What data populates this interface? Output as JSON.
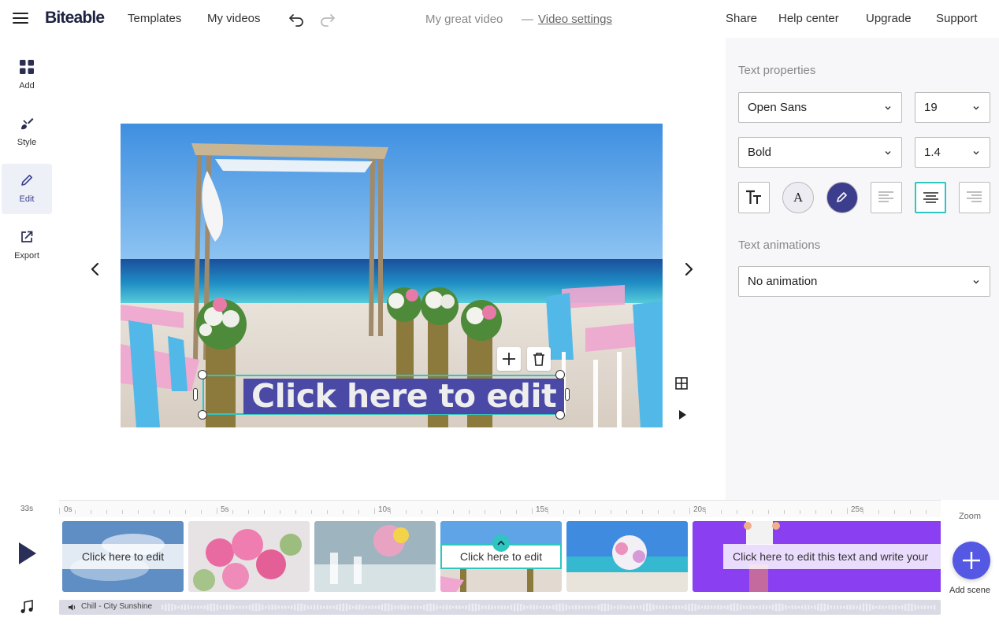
{
  "topbar": {
    "logo": "Biteable",
    "nav": [
      "Templates",
      "My videos"
    ],
    "video_title": "My great video",
    "separator": "—",
    "video_settings": "Video settings",
    "right_links": [
      "Share",
      "Help center",
      "Upgrade",
      "Support"
    ]
  },
  "left_toolbar": [
    {
      "label": "Add",
      "icon": "grid-icon"
    },
    {
      "label": "Style",
      "icon": "paint-brush-icon"
    },
    {
      "label": "Edit",
      "icon": "pencil-icon",
      "active": true
    },
    {
      "label": "Export",
      "icon": "export-icon"
    }
  ],
  "canvas": {
    "caption": "Click here to edit"
  },
  "properties": {
    "text_properties_title": "Text properties",
    "font_family": "Open Sans",
    "font_size": "19",
    "font_weight": "Bold",
    "line_height": "1.4",
    "color_letter": "A",
    "text_animations_title": "Text animations",
    "animation": "No animation",
    "alignment": "center"
  },
  "timeline": {
    "duration": "33s",
    "ruler_marks": [
      "0s",
      "5s",
      "10s",
      "15s",
      "20s",
      "25s"
    ],
    "clips": [
      {
        "label": "Click here to edit",
        "theme": "sky"
      },
      {
        "label": "",
        "theme": "roses"
      },
      {
        "label": "",
        "theme": "table"
      },
      {
        "label": "Click here to edit",
        "theme": "beach",
        "selected": true
      },
      {
        "label": "",
        "theme": "bouquet"
      },
      {
        "label": "Click here to edit this text and write your",
        "theme": "purple"
      }
    ],
    "audio_track": "Chill - City Sunshine",
    "zoom_label": "Zoom",
    "add_scene_label": "Add scene"
  },
  "colors": {
    "accent_teal": "#2fc5c0",
    "caption_bg": "#4a4aa6",
    "add_scene": "#5558e3",
    "purple_clip": "#8a3ff0"
  }
}
